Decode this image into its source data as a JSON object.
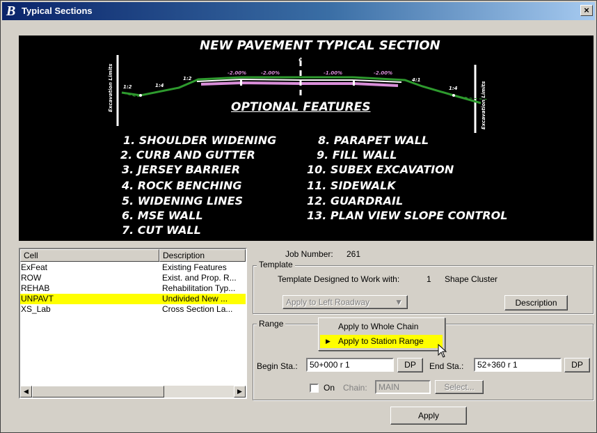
{
  "window": {
    "title": "Typical Sections",
    "close_label": "×",
    "logo": "bentley-logo-icon"
  },
  "preview": {
    "title": "NEW PAVEMENT TYPICAL SECTION",
    "subtitle": "OPTIONAL FEATURES",
    "left_label": "Excavation Limits",
    "right_label": "Excavation Limits",
    "slope_labels": [
      "-2.00%",
      "-2.00%",
      "-1.00%",
      "-2.00%"
    ],
    "side_slopes": [
      "1:2",
      "1:4",
      "1:2",
      "4:1",
      "1:4"
    ],
    "centerline_mark": "¢",
    "features_left": [
      "1.  SHOULDER WIDENING",
      "2.  CURB AND GUTTER",
      "3.  JERSEY BARRIER",
      "4.  ROCK BENCHING",
      "5.  WIDENING LINES",
      "6.  MSE WALL",
      "7.  CUT WALL"
    ],
    "features_right": [
      "8.  PARAPET WALL",
      "9.  FILL WALL",
      "10.  SUBEX EXCAVATION",
      "11.  SIDEWALK",
      "12.  GUARDRAIL",
      "13.  PLAN VIEW SLOPE CONTROL"
    ]
  },
  "list": {
    "headers": [
      "Cell",
      "Description"
    ],
    "rows": [
      {
        "cell": "ExFeat",
        "description": "Existing Features"
      },
      {
        "cell": "ROW",
        "description": "Exist. and Prop. R..."
      },
      {
        "cell": "REHAB",
        "description": "Rehabilitation Typ..."
      },
      {
        "cell": "UNPAVT",
        "description": "Undivided New ..."
      },
      {
        "cell": "XS_Lab",
        "description": "Cross Section La..."
      }
    ],
    "selected_index": 3,
    "scroll_left": "◀",
    "scroll_right": "▶"
  },
  "job": {
    "label": "Job Number:",
    "value": "261"
  },
  "template": {
    "group_label": "Template",
    "designed_label": "Template Designed to Work with:",
    "designed_count": "1",
    "designed_type": "Shape Cluster",
    "apply_dropdown": "Apply to Left Roadway",
    "description_button": "Description"
  },
  "range": {
    "group_label": "Range",
    "menu": [
      "Apply to Whole Chain",
      "Apply to Station Range"
    ],
    "selected_menu": "Apply to Station Range",
    "begin_label": "Begin Sta.:",
    "begin_value": "50+000 r 1",
    "end_label": "End Sta.:",
    "end_value": "52+360 r 1",
    "dp_label": "DP",
    "on_label": "On",
    "chain_label": "Chain:",
    "chain_value": "MAIN",
    "select_button": "Select..."
  },
  "apply_button": "Apply",
  "colors": {
    "selection": "#ffff00",
    "title_bar": "#0a246a",
    "preview_bg": "#000000"
  }
}
